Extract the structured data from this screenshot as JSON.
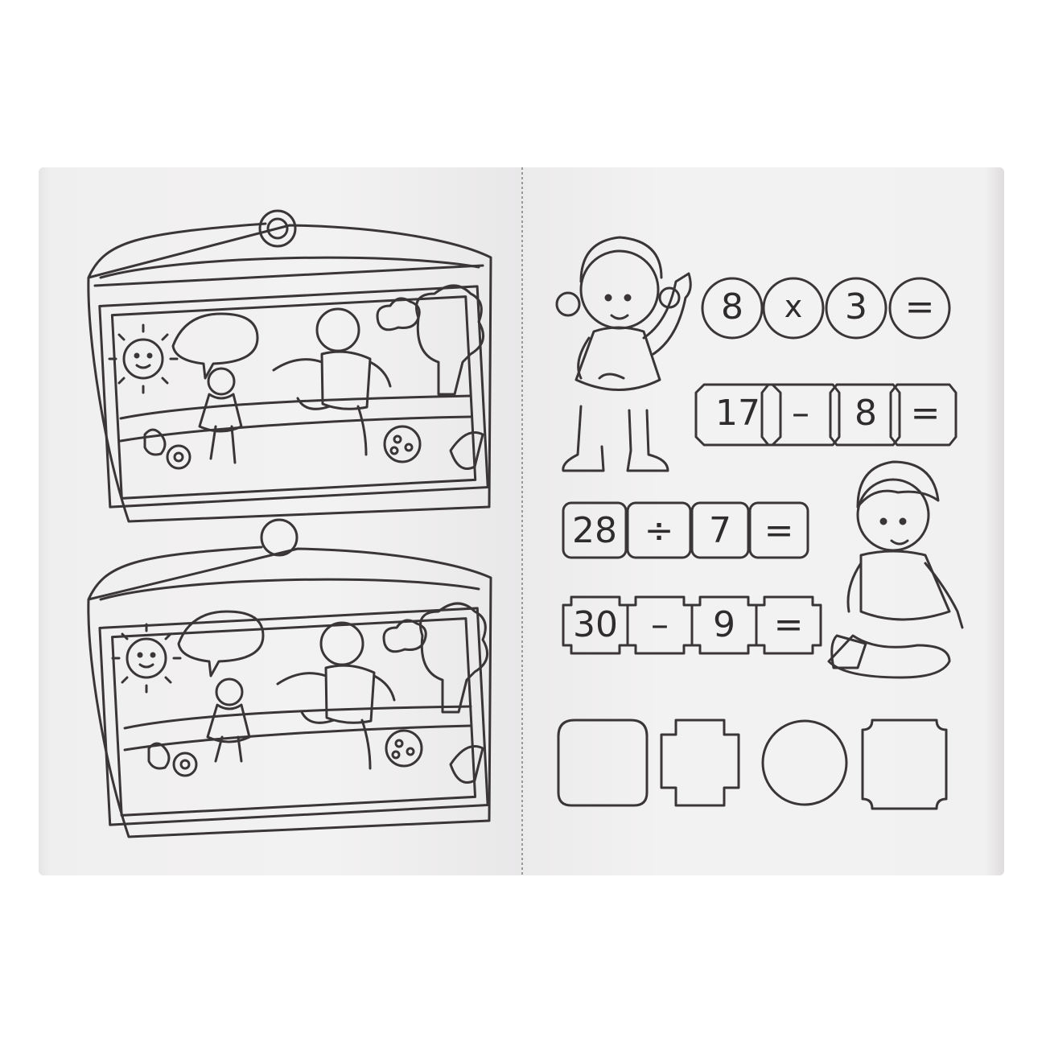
{
  "worksheet": {
    "equations": [
      {
        "a": "8",
        "op": "x",
        "b": "3",
        "eq": "="
      },
      {
        "a": "17",
        "op": "–",
        "b": "8",
        "eq": "="
      },
      {
        "a": "28",
        "op": "÷",
        "b": "7",
        "eq": "="
      },
      {
        "a": "30",
        "op": "–",
        "b": "9",
        "eq": "="
      }
    ]
  },
  "colors": {
    "paper": "#f2f1f1",
    "ink": "#2f2c2d"
  },
  "illustrations": [
    "spot-the-difference-top",
    "spot-the-difference-bottom",
    "girl-waving",
    "boy-sitting",
    "answer-shapes"
  ]
}
